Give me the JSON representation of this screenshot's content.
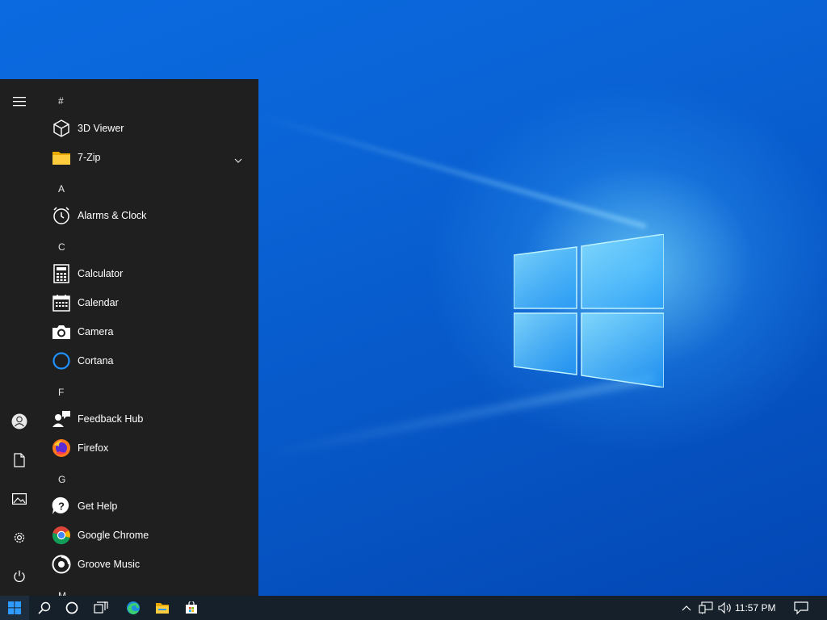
{
  "start_menu": {
    "sections": [
      {
        "header": "#",
        "apps": [
          {
            "label": "3D Viewer",
            "icon": "3d-viewer-icon"
          },
          {
            "label": "7-Zip",
            "icon": "folder-icon",
            "expandable": true
          }
        ]
      },
      {
        "header": "A",
        "apps": [
          {
            "label": "Alarms & Clock",
            "icon": "alarm-clock-icon"
          }
        ]
      },
      {
        "header": "C",
        "apps": [
          {
            "label": "Calculator",
            "icon": "calculator-icon"
          },
          {
            "label": "Calendar",
            "icon": "calendar-icon"
          },
          {
            "label": "Camera",
            "icon": "camera-icon"
          },
          {
            "label": "Cortana",
            "icon": "cortana-icon"
          }
        ]
      },
      {
        "header": "F",
        "apps": [
          {
            "label": "Feedback Hub",
            "icon": "feedback-hub-icon"
          },
          {
            "label": "Firefox",
            "icon": "firefox-icon"
          }
        ]
      },
      {
        "header": "G",
        "apps": [
          {
            "label": "Get Help",
            "icon": "get-help-icon"
          },
          {
            "label": "Google Chrome",
            "icon": "chrome-icon"
          },
          {
            "label": "Groove Music",
            "icon": "groove-music-icon"
          }
        ]
      },
      {
        "header": "M",
        "apps": []
      }
    ],
    "rail": [
      "hamburger-menu-icon",
      "user-account-icon",
      "documents-icon",
      "pictures-icon",
      "settings-gear-icon",
      "power-icon"
    ]
  },
  "taskbar": {
    "pinned": [
      "windows-start-icon",
      "search-icon",
      "cortana-circle-icon",
      "task-view-icon",
      "edge-icon",
      "file-explorer-icon",
      "microsoft-store-icon"
    ],
    "tray": [
      "show-hidden-icons-chevron",
      "network-icon",
      "volume-icon"
    ],
    "clock": "11:57 PM",
    "notification_icon": "action-center-icon"
  },
  "colors": {
    "start_bg": "#1f1f1f",
    "taskbar_bg": "#15202b",
    "accent": "#0078d7",
    "cortana_ring": "#1e90ff"
  }
}
